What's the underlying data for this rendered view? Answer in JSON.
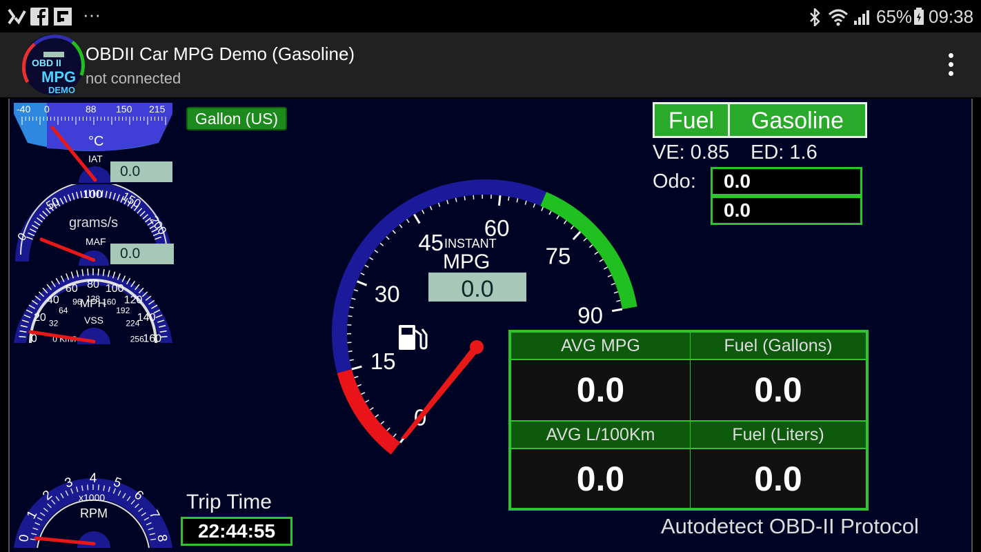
{
  "statusbar": {
    "battery_percent": "65%",
    "time": "09:38",
    "overflow": "···"
  },
  "appbar": {
    "title": "OBDII Car MPG Demo (Gasoline)",
    "subtitle": "not connected",
    "logo": {
      "line1": "OBD II",
      "line2": "MPG",
      "line3": "DEMO"
    }
  },
  "unit_badge": "Gallon (US)",
  "iat_gauge": {
    "ticks": [
      "-40",
      "0",
      "88",
      "150",
      "215"
    ],
    "unit": "°C",
    "label": "IAT",
    "value": "0.0",
    "needle_value": -40,
    "range": [
      -40,
      215
    ]
  },
  "maf_gauge": {
    "ticks": [
      "0",
      "50",
      "100",
      "150",
      "200"
    ],
    "unit": "grams/s",
    "label": "MAF",
    "value": "0.0",
    "needle_value": 0,
    "range": [
      0,
      200
    ]
  },
  "vss_gauge": {
    "outer_ticks": [
      "0",
      "20",
      "40",
      "60",
      "80",
      "100",
      "120",
      "140",
      "160"
    ],
    "inner_ticks": [
      "0 Km/h",
      "32",
      "64",
      "96",
      "128",
      "160",
      "192",
      "224",
      "256"
    ],
    "unit": "MPH",
    "label": "VSS",
    "needle_value": 0,
    "range": [
      0,
      160
    ]
  },
  "rpm_gauge": {
    "ticks": [
      "0",
      "1",
      "2",
      "3",
      "4",
      "5",
      "6",
      "7",
      "8"
    ],
    "multiplier": "x1000",
    "unit": "RPM",
    "needle_value": 0,
    "range": [
      0,
      8
    ]
  },
  "mpg_gauge": {
    "ticks": [
      "0",
      "15",
      "30",
      "45",
      "60",
      "75",
      "90"
    ],
    "label_top": "INSTANT",
    "label_bottom": "MPG",
    "value": "0.0",
    "needle_value": 0,
    "range": [
      0,
      90
    ],
    "icon": "fuel-pump-icon",
    "colors": {
      "low": "#e8141a",
      "mid": "#1a1a9a",
      "high": "#20c020"
    }
  },
  "fuel": {
    "label": "Fuel",
    "type": "Gasoline"
  },
  "ve_label": "VE: 0.85",
  "ed_label": "ED: 1.6",
  "odo": {
    "label": "Odo:",
    "value1": "0.0",
    "value2": "0.0"
  },
  "stats": {
    "avg_mpg_label": "AVG MPG",
    "avg_mpg": "0.0",
    "fuel_gallons_label": "Fuel (Gallons)",
    "fuel_gallons": "0.0",
    "avg_l100_label": "AVG L/100Km",
    "avg_l100": "0.0",
    "fuel_liters_label": "Fuel (Liters)",
    "fuel_liters": "0.0"
  },
  "trip": {
    "label": "Trip Time",
    "value": "22:44:55"
  },
  "protocol": "Autodetect OBD-II Protocol"
}
